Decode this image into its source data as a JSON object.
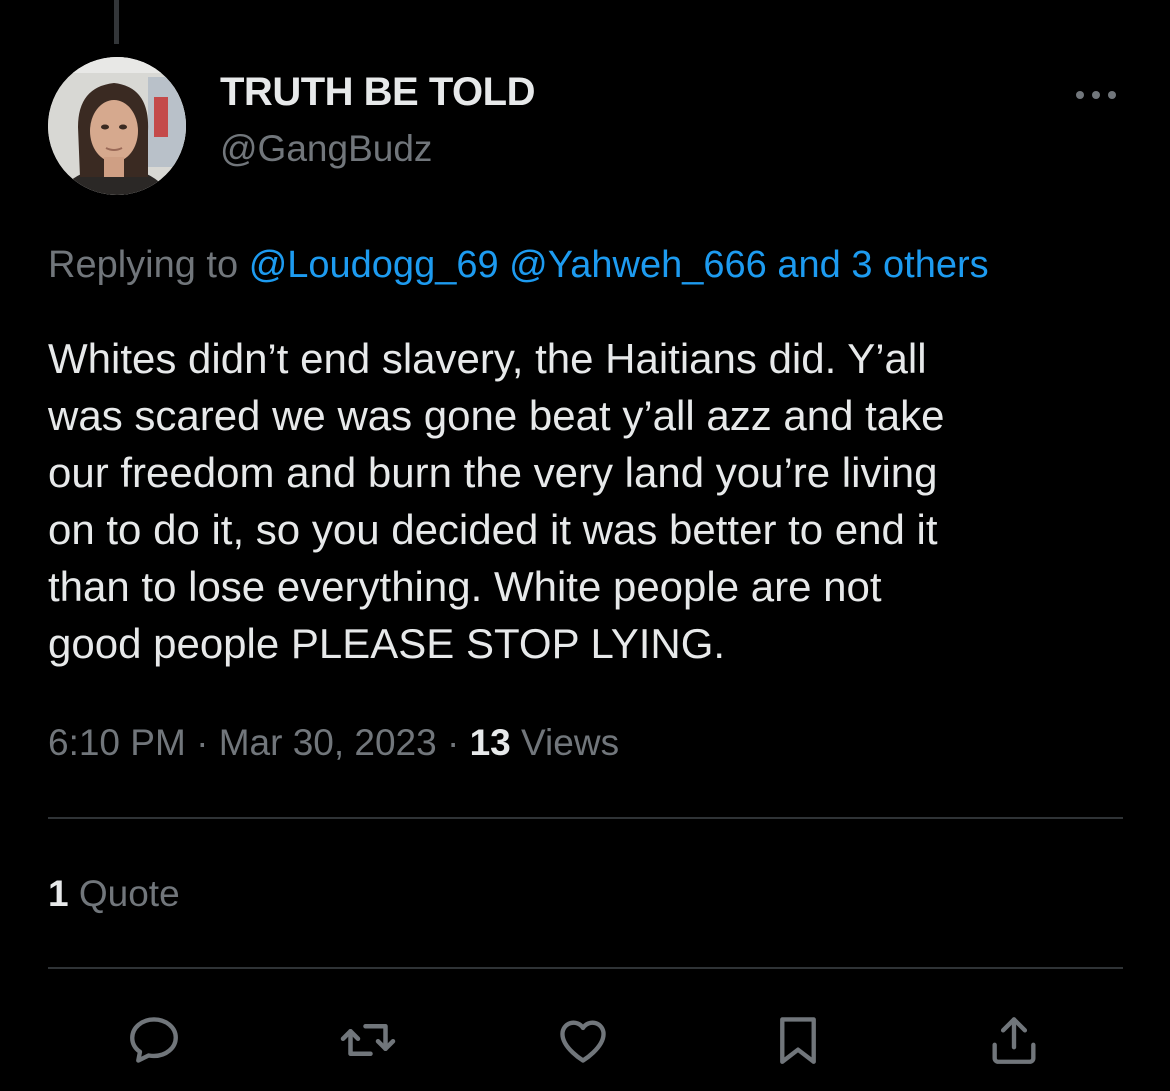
{
  "author": {
    "display_name": "TRUTH BE TOLD",
    "handle": "@GangBudz"
  },
  "reply_context": {
    "prefix": "Replying to",
    "mentions": [
      "@Loudogg_69",
      "@Yahweh_666"
    ],
    "others": "and 3 others"
  },
  "tweet": {
    "text": "Whites didn’t end slavery, the Haitians did. Y’all\nwas scared we was gone beat y’all azz and take\nour freedom and burn the very land you’re living\non to do it, so you decided it was better to end it\nthan to lose everything. White people are not\ngood people PLEASE STOP LYING."
  },
  "meta": {
    "time": "6:10 PM",
    "separator": "·",
    "date": "Mar 30, 2023",
    "views_count": "13",
    "views_label": "Views"
  },
  "stats": {
    "quote_count": "1",
    "quote_label": "Quote"
  },
  "actions": [
    {
      "name": "reply-icon"
    },
    {
      "name": "retweet-icon"
    },
    {
      "name": "like-icon"
    },
    {
      "name": "bookmark-icon"
    },
    {
      "name": "share-icon"
    }
  ],
  "colors": {
    "background": "#000000",
    "text_primary": "#e7e9ea",
    "text_secondary": "#71767b",
    "link": "#1d9bf0",
    "divider": "#2f3336"
  }
}
